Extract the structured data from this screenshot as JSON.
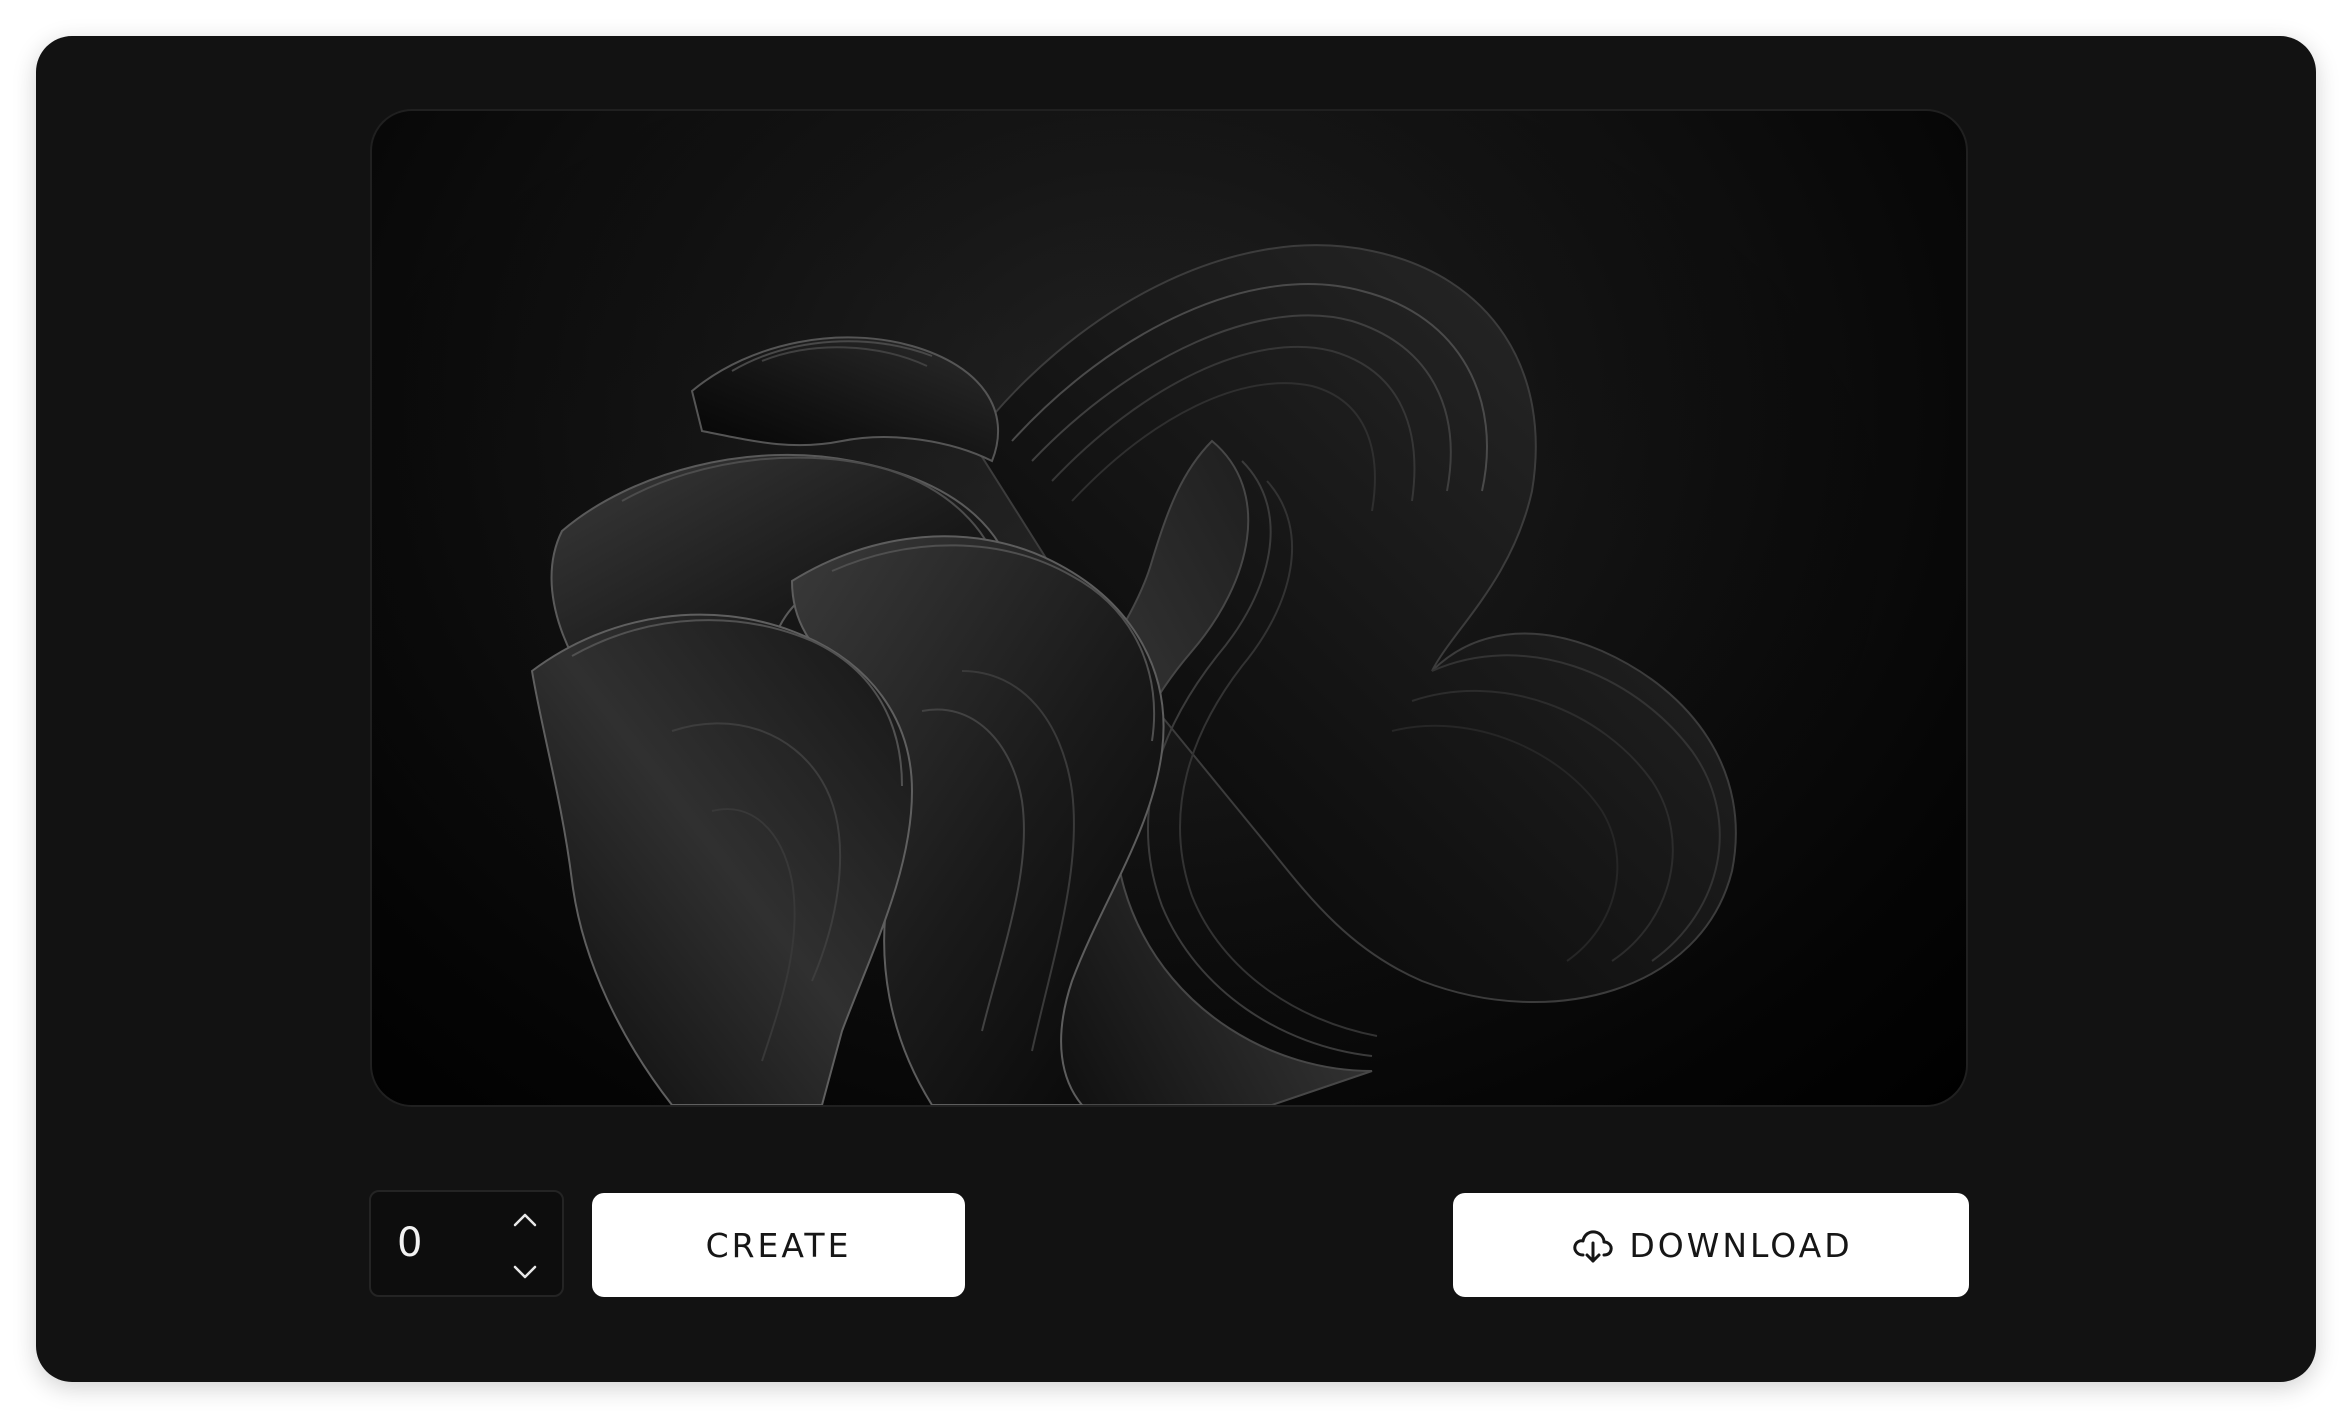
{
  "stepper": {
    "value": "0",
    "up_icon": "chevron-up-icon",
    "down_icon": "chevron-down-icon"
  },
  "actions": {
    "create_label": "CREATE",
    "download_label": "DOWNLOAD",
    "download_icon": "cloud-download-icon"
  },
  "preview": {
    "image_subject": "abstract-dark-ribbon-bloom"
  },
  "colors": {
    "window_bg": "#121212",
    "button_bg": "#ffffff",
    "button_text": "#161616"
  }
}
